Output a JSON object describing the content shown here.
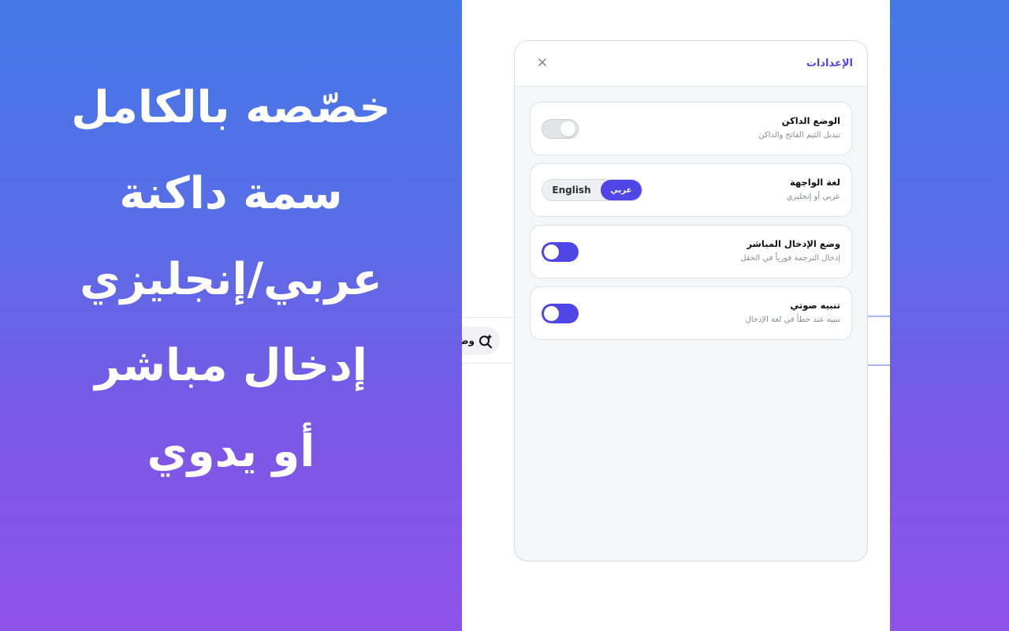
{
  "promo": {
    "lines": [
      "خصّصه بالكامل",
      "سمة داكنة",
      "عربي/إنجليزي",
      "إدخال مباشر",
      "أو يدوي"
    ]
  },
  "host_page": {
    "chip_text": "وض",
    "chip_icon": "sparkle-search-icon"
  },
  "settings": {
    "title": "الإعدادات",
    "close_icon": "close-icon",
    "items": [
      {
        "label": "الوضع الداكن",
        "description": "تبديل الثيم الفاتح والداكن",
        "control": "toggle",
        "state": "off"
      },
      {
        "label": "لغة الواجهة",
        "description": "عربي أو إنجليزي",
        "control": "segmented",
        "options": [
          "English",
          "عربي"
        ],
        "selected": "عربي"
      },
      {
        "label": "وضع الإدخال المباشر",
        "description": "إدخال الترجمة فورياً في الحقل",
        "control": "toggle",
        "state": "on"
      },
      {
        "label": "تنبيه صوتي",
        "description": "تنبيه عند خطأ في لغة الإدخال",
        "control": "toggle",
        "state": "on"
      }
    ]
  },
  "colors": {
    "accent": "#4f46e5",
    "gradient_top": "#4479e6",
    "gradient_bottom": "#8d52e6"
  }
}
